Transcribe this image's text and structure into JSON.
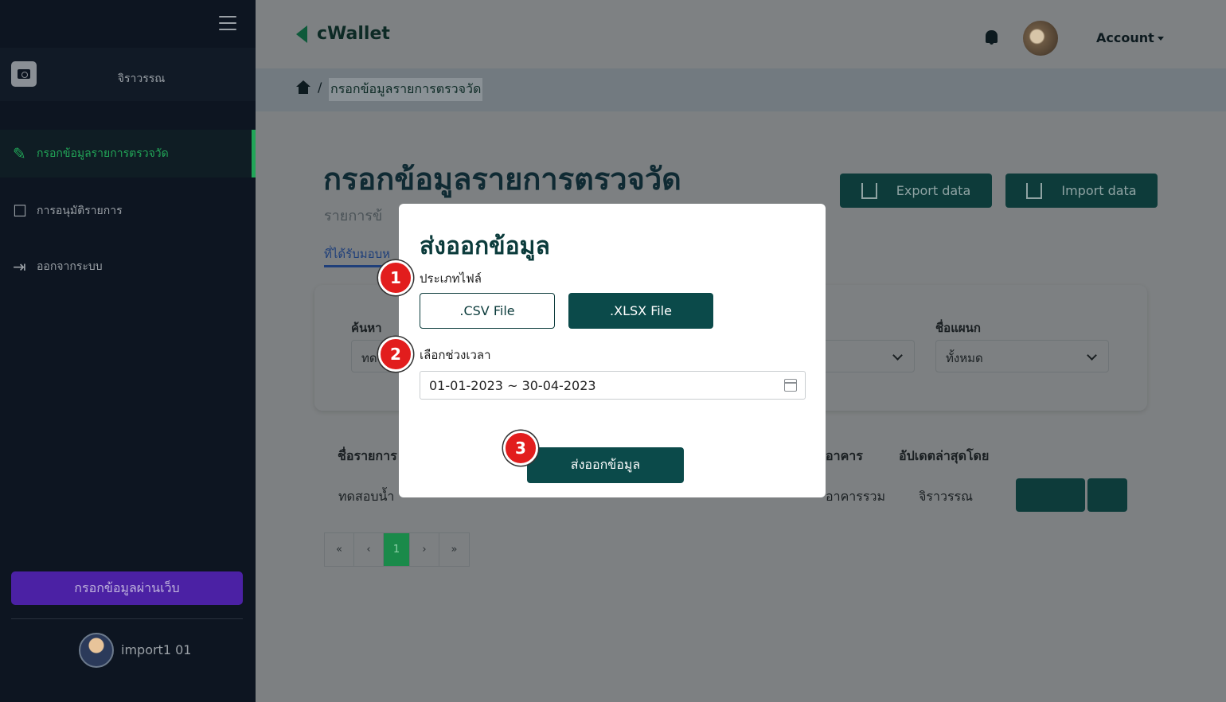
{
  "sidebar": {
    "username": "จิราวรรณ",
    "items": [
      {
        "label": "กรอกข้อมูลรายการตรวจวัด",
        "icon": "pencil-icon",
        "active": true
      },
      {
        "label": "การอนุมัติรายการ",
        "icon": "approval-icon",
        "active": false
      },
      {
        "label": "ออกจากระบบ",
        "icon": "logout-icon",
        "active": false
      }
    ],
    "web_entry_button": "กรอกข้อมูลผ่านเว็บ",
    "account_name": "import1 01"
  },
  "header": {
    "logo": "cWallet",
    "account_label": "Account"
  },
  "breadcrumb": {
    "current": "กรอกข้อมูลรายการตรวจวัด"
  },
  "main": {
    "title": "กรอกข้อมูลรายการตรวจวัด",
    "subtitle": "รายการข้",
    "tab": "ที่ได้รับมอบห",
    "export_button": "Export data",
    "import_button": "Import data",
    "filters": {
      "search_label": "ค้นหา",
      "search_value": "ทด",
      "department_label": "ชื่อแผนก",
      "department_value": "ทั้งหมด"
    },
    "table": {
      "headers": [
        "ชื่อรายการ",
        "อาคาร",
        "อัปเดตล่าสุดโดย"
      ],
      "row": {
        "name": "ทดสอบน้ำ",
        "building": "อาคารรวม",
        "updated_by": "จิราวรรณ"
      }
    },
    "pagination": {
      "first": "«",
      "prev": "‹",
      "current": "1",
      "next": "›",
      "last": "»"
    }
  },
  "modal": {
    "title": "ส่งออกข้อมูล",
    "file_type_label": "ประเภทไฟล์",
    "csv_label": ".CSV File",
    "xlsx_label": ".XLSX File",
    "date_label": "เลือกช่วงเวลา",
    "date_range": "01-01-2023 ~ 30-04-2023",
    "export_button": "ส่งออกข้อมูล",
    "steps": [
      "1",
      "2",
      "3"
    ]
  },
  "colors": {
    "brand": "#0b4a4a",
    "active_nav": "#22a658",
    "web_button": "#4b21a4",
    "step_badge": "#e21d1d"
  }
}
